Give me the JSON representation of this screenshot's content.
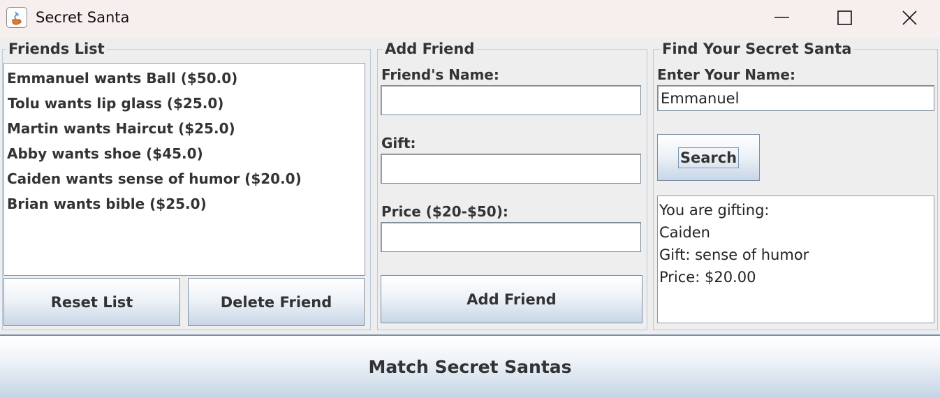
{
  "window": {
    "title": "Secret Santa"
  },
  "friends_list": {
    "title": "Friends List",
    "items": [
      "Emmanuel wants Ball ($50.0)",
      "Tolu wants lip glass ($25.0)",
      "Martin wants Haircut ($25.0)",
      "Abby wants shoe ($45.0)",
      "Caiden wants sense of humor ($20.0)",
      "Brian wants bible ($25.0)"
    ],
    "reset_label": "Reset List",
    "delete_label": "Delete Friend"
  },
  "add_friend": {
    "title": "Add Friend",
    "name_label": "Friend's Name:",
    "name_value": "",
    "gift_label": "Gift:",
    "gift_value": "",
    "price_label": "Price ($20-$50):",
    "price_value": "",
    "button_label": "Add Friend"
  },
  "find_santa": {
    "title": "Find Your Secret Santa",
    "name_label": "Enter Your Name:",
    "name_value": "Emmanuel",
    "search_label": "Search",
    "result_lines": [
      "You are gifting:",
      "Caiden",
      "Gift: sense of humor",
      "Price: $20.00"
    ]
  },
  "match_button_label": "Match Secret Santas"
}
